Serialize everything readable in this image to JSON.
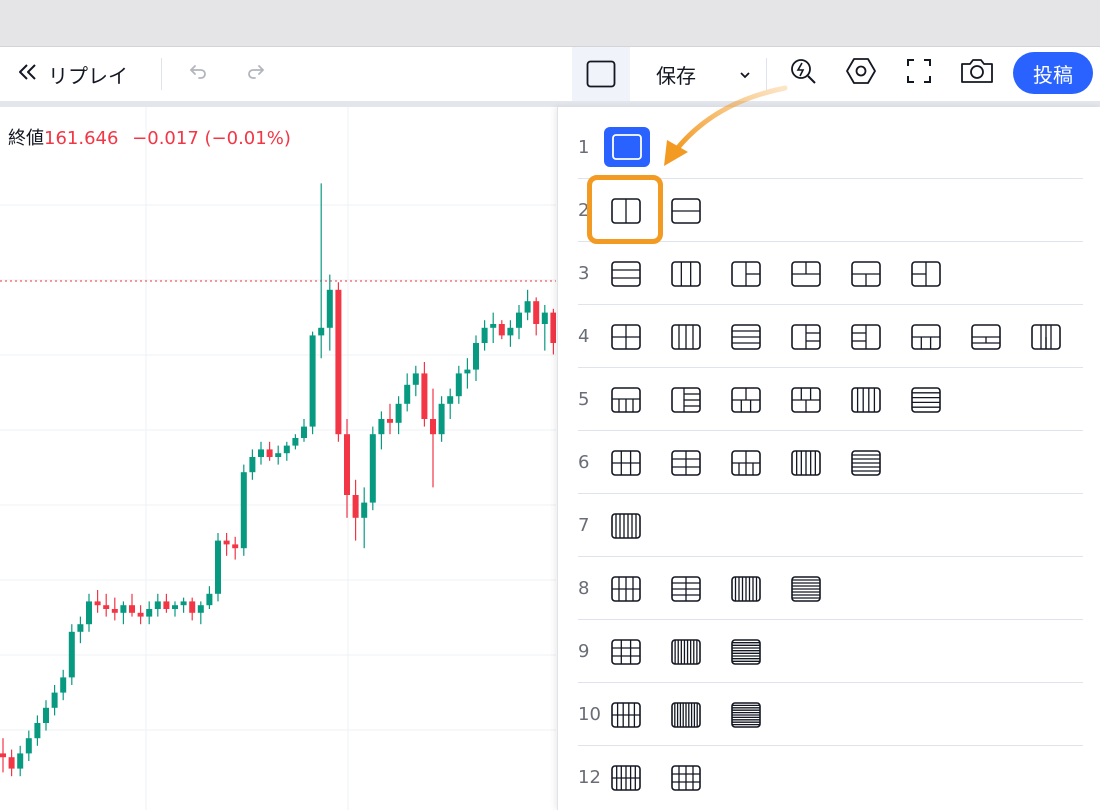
{
  "toolbar": {
    "replay_label": "リプレイ",
    "save_label": "保存",
    "post_label": "投稿"
  },
  "legend": {
    "label": "終値",
    "price": "161.646",
    "change": "−0.017",
    "change_pct": "(−0.01%)"
  },
  "layout_menu": {
    "selected": "1",
    "rows": [
      {
        "label": "1",
        "layouts": [
          "s"
        ]
      },
      {
        "label": "2",
        "layouts": [
          "2v",
          "2h"
        ]
      },
      {
        "label": "3",
        "layouts": [
          "3h",
          "3v",
          "3L",
          "3T",
          "3B",
          "3R"
        ]
      },
      {
        "label": "4",
        "layouts": [
          "4g",
          "4v",
          "4h",
          "4L",
          "4R",
          "4B",
          "4T",
          "4V3"
        ]
      },
      {
        "label": "5",
        "layouts": [
          "5B",
          "5L",
          "5a",
          "5b",
          "5v",
          "5h"
        ]
      },
      {
        "label": "6",
        "layouts": [
          "6g",
          "6h",
          "6b",
          "6v",
          "6hh"
        ]
      },
      {
        "label": "7",
        "layouts": [
          "7v"
        ]
      },
      {
        "label": "8",
        "layouts": [
          "8g",
          "8h",
          "8v",
          "8hh"
        ]
      },
      {
        "label": "9",
        "layouts": [
          "9g",
          "9v",
          "9h"
        ]
      },
      {
        "label": "10",
        "layouts": [
          "10g",
          "10v",
          "10h"
        ]
      },
      {
        "label": "12",
        "layouts": [
          "12v",
          "12g"
        ]
      }
    ]
  },
  "chart_data": {
    "type": "candlestick",
    "last_close": 161.646,
    "colors": {
      "up": "#089981",
      "down": "#f23645",
      "last_line": "#f23645"
    },
    "candles": [
      [
        149.2,
        149.6,
        148.7,
        149.1
      ],
      [
        149.1,
        149.3,
        148.6,
        148.8
      ],
      [
        148.8,
        149.4,
        148.6,
        149.2
      ],
      [
        149.2,
        149.8,
        149.0,
        149.6
      ],
      [
        149.6,
        150.2,
        149.4,
        150.0
      ],
      [
        150.0,
        150.6,
        149.8,
        150.4
      ],
      [
        150.4,
        151.0,
        150.2,
        150.8
      ],
      [
        150.8,
        151.4,
        150.6,
        151.2
      ],
      [
        151.2,
        152.6,
        151.0,
        152.4
      ],
      [
        152.4,
        152.8,
        152.1,
        152.6
      ],
      [
        152.6,
        153.4,
        152.4,
        153.2
      ],
      [
        153.2,
        153.5,
        152.9,
        153.1
      ],
      [
        153.1,
        153.4,
        152.8,
        153.0
      ],
      [
        153.0,
        153.3,
        152.7,
        152.9
      ],
      [
        152.9,
        153.2,
        152.6,
        153.1
      ],
      [
        153.1,
        153.4,
        152.8,
        152.9
      ],
      [
        152.9,
        153.1,
        152.6,
        152.8
      ],
      [
        152.8,
        153.2,
        152.6,
        153.0
      ],
      [
        153.0,
        153.4,
        152.8,
        153.2
      ],
      [
        153.2,
        153.4,
        152.9,
        153.0
      ],
      [
        153.0,
        153.2,
        152.8,
        153.1
      ],
      [
        153.1,
        153.3,
        152.9,
        153.2
      ],
      [
        153.2,
        153.3,
        152.7,
        152.9
      ],
      [
        152.9,
        153.2,
        152.6,
        153.1
      ],
      [
        153.1,
        153.6,
        153.0,
        153.4
      ],
      [
        153.4,
        155.0,
        153.2,
        154.8
      ],
      [
        154.8,
        155.0,
        154.4,
        154.7
      ],
      [
        154.7,
        154.9,
        154.3,
        154.6
      ],
      [
        154.6,
        156.8,
        154.4,
        156.6
      ],
      [
        156.6,
        157.2,
        156.4,
        157.0
      ],
      [
        157.0,
        157.4,
        156.8,
        157.2
      ],
      [
        157.2,
        157.4,
        156.9,
        157.0
      ],
      [
        157.0,
        157.3,
        156.8,
        157.1
      ],
      [
        157.1,
        157.4,
        156.9,
        157.3
      ],
      [
        157.3,
        157.6,
        157.2,
        157.5
      ],
      [
        157.5,
        158.0,
        157.4,
        157.8
      ],
      [
        157.8,
        160.3,
        157.6,
        160.2
      ],
      [
        160.2,
        164.2,
        159.6,
        160.4
      ],
      [
        160.4,
        161.8,
        159.8,
        161.4
      ],
      [
        161.4,
        161.6,
        157.4,
        157.6
      ],
      [
        157.6,
        158.0,
        155.4,
        156.0
      ],
      [
        156.0,
        156.4,
        154.8,
        155.4
      ],
      [
        155.4,
        156.2,
        154.6,
        155.8
      ],
      [
        155.8,
        157.8,
        155.6,
        157.6
      ],
      [
        157.6,
        158.2,
        157.2,
        158.0
      ],
      [
        158.0,
        158.4,
        157.6,
        157.9
      ],
      [
        157.9,
        158.6,
        157.6,
        158.4
      ],
      [
        158.4,
        159.2,
        158.2,
        158.9
      ],
      [
        158.9,
        159.4,
        158.6,
        159.2
      ],
      [
        159.2,
        159.5,
        157.8,
        158.0
      ],
      [
        158.0,
        158.8,
        156.2,
        157.6
      ],
      [
        157.6,
        158.6,
        157.4,
        158.4
      ],
      [
        158.4,
        158.8,
        158.0,
        158.6
      ],
      [
        158.6,
        159.4,
        158.4,
        159.2
      ],
      [
        159.2,
        159.6,
        158.8,
        159.3
      ],
      [
        159.3,
        160.2,
        159.0,
        160.0
      ],
      [
        160.0,
        160.6,
        159.8,
        160.4
      ],
      [
        160.4,
        160.8,
        160.0,
        160.5
      ],
      [
        160.5,
        160.6,
        160.1,
        160.2
      ],
      [
        160.2,
        160.6,
        159.9,
        160.4
      ],
      [
        160.4,
        161.0,
        160.1,
        160.8
      ],
      [
        160.8,
        161.4,
        160.6,
        161.1
      ],
      [
        161.1,
        161.2,
        160.2,
        160.5
      ],
      [
        160.5,
        161.0,
        159.8,
        160.8
      ],
      [
        160.8,
        160.9,
        159.7,
        160.0
      ]
    ]
  }
}
